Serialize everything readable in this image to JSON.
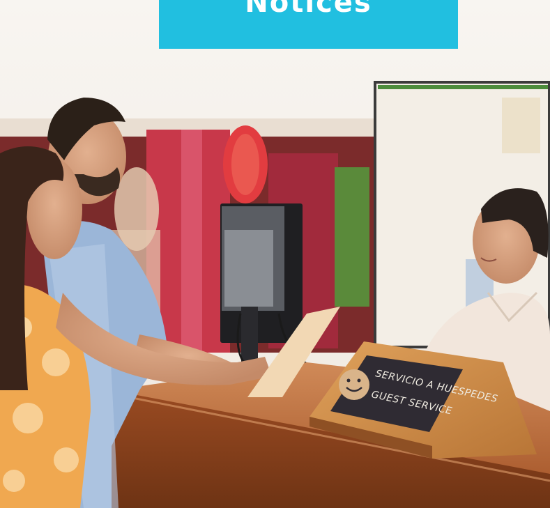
{
  "banner": {
    "title": "Notices",
    "color": "#21bfe0"
  },
  "photo": {
    "sign": {
      "line1": "SERVICIO A HUESPEDES",
      "line2": "GUEST SERVICE",
      "icon": "smiley-face-icon"
    }
  }
}
